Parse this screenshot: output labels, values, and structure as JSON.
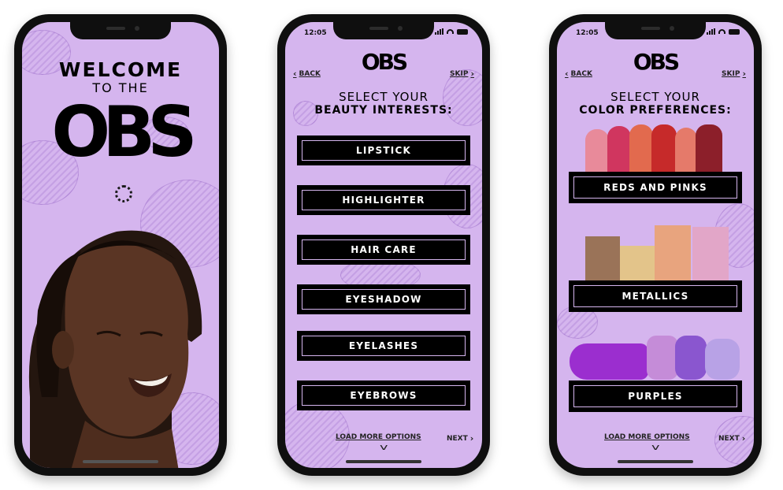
{
  "phone1": {
    "welcome_line1": "WELCOME",
    "welcome_line2": "TO THE",
    "brand": "OBS"
  },
  "phone2": {
    "status_time": "12:05",
    "logo": "OBS",
    "back_label": "BACK",
    "skip_label": "SKIP",
    "heading_line1": "SELECT YOUR",
    "heading_line2": "BEAUTY INTERESTS:",
    "options": [
      {
        "label": "LIPSTICK"
      },
      {
        "label": "HIGHLIGHTER"
      },
      {
        "label": "HAIR CARE"
      },
      {
        "label": "EYESHADOW"
      },
      {
        "label": "EYELASHES"
      },
      {
        "label": "EYEBROWS"
      }
    ],
    "load_more_label": "LOAD MORE OPTIONS",
    "next_label": "NEXT"
  },
  "phone3": {
    "status_time": "12:05",
    "logo": "OBS",
    "back_label": "BACK",
    "skip_label": "SKIP",
    "heading_line1": "SELECT YOUR",
    "heading_line2": "COLOR PREFERENCES:",
    "options": [
      {
        "label": "REDS AND PINKS"
      },
      {
        "label": "METALLICS"
      },
      {
        "label": "PURPLES"
      }
    ],
    "load_more_label": "LOAD MORE OPTIONS",
    "next_label": "NEXT"
  },
  "colors": {
    "screen_bg": "#d5b5ee",
    "button_bg": "#000000",
    "button_text": "#ffffff",
    "lipstick_swatches": [
      "#e88a9a",
      "#d0365f",
      "#e26a4e",
      "#c62a2a",
      "#e57a6a",
      "#8c1f2a"
    ],
    "metallic_swatches": [
      "#9a7358",
      "#e3c48a",
      "#e8a47e",
      "#e2a6c8"
    ],
    "purple_swatches": [
      "#9b2ecf",
      "#c58cd8",
      "#8a56cf",
      "#b8a2e6"
    ]
  }
}
